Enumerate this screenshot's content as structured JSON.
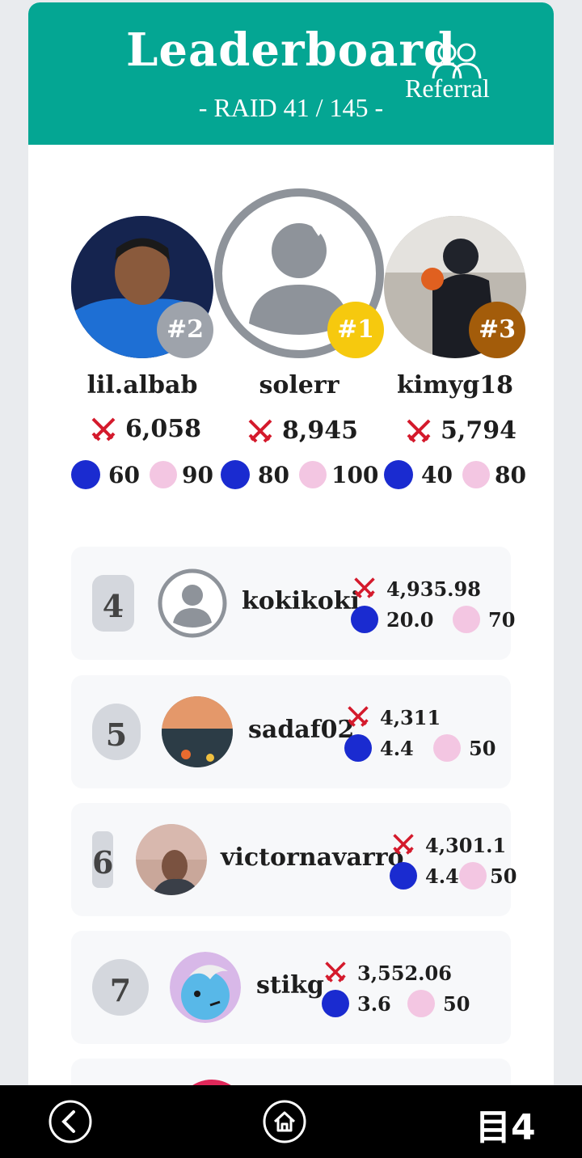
{
  "header": {
    "title": "Leaderboard",
    "subtitle": "- RAID 41 / 145 -",
    "referral_label": "Referral",
    "referral_icon": "users-icon",
    "color": "#04a693"
  },
  "podium": [
    {
      "rank_label": "#2",
      "name": "lil.albab",
      "score": "6,058",
      "steem": "60",
      "tokens": "90",
      "badge_color": "#9ea3ab"
    },
    {
      "rank_label": "#1",
      "name": "solerr",
      "score": "8,945",
      "steem": "80",
      "tokens": "100",
      "badge_color": "#f6c90e"
    },
    {
      "rank_label": "#3",
      "name": "kimyg18",
      "score": "5,794",
      "steem": "40",
      "tokens": "80",
      "badge_color": "#a35c0a"
    }
  ],
  "rows": [
    {
      "rank": "4",
      "name": "kokikoki",
      "score": "4,935.98",
      "steem": "20.0",
      "tokens": "70"
    },
    {
      "rank": "5",
      "name": "sadaf02",
      "score": "4,311",
      "steem": "4.4",
      "tokens": "50"
    },
    {
      "rank": "6",
      "name": "victornavarro",
      "score": "4,301.1",
      "steem": "4.4",
      "tokens": "50"
    },
    {
      "rank": "7",
      "name": "stikg",
      "score": "3,552.06",
      "steem": "3.6",
      "tokens": "50"
    }
  ],
  "nav": {
    "back_icon": "chevron-left-icon",
    "home_icon": "home-icon",
    "logo_text": "目4"
  },
  "colors": {
    "steem": "#1a2bd0",
    "sword": "#d41a2c"
  }
}
